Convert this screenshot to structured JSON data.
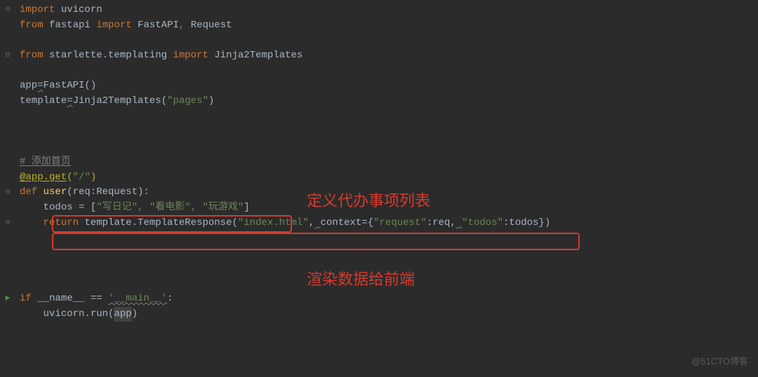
{
  "code": {
    "l1": {
      "kw1": "import",
      "mod": " uvicorn"
    },
    "l2": {
      "kw1": "from",
      "mod": " fastapi ",
      "kw2": "import",
      "names": " FastAPI",
      "comma": ", ",
      "names2": "Request"
    },
    "l4": {
      "kw1": "from",
      "mod": " starlette.templating ",
      "kw2": "import",
      "names": " Jinja2Templates"
    },
    "l6": {
      "var": "app",
      "eq": "=",
      "call": "FastAPI()"
    },
    "l7": {
      "var": "template",
      "eq": "=",
      "call": "Jinja2Templates(",
      "str": "\"pages\"",
      "end": ")"
    },
    "l11": {
      "comment": "# 添加首页"
    },
    "l12": {
      "dec": "@app.get",
      "open": "(",
      "str": "\"/\"",
      "close": ")"
    },
    "l13": {
      "kw": "def ",
      "fn": "user",
      "sig": "(req:Request):"
    },
    "l14": {
      "indent": "    ",
      "var": "todos = [",
      "s1": "\"写日记\"",
      "c1": ", ",
      "s2": "\"看电影\"",
      "c2": ", ",
      "s3": "\"玩游戏\"",
      "end": "]"
    },
    "l15": {
      "indent": "    ",
      "kw": "return",
      "sp": " ",
      "obj": "template.TemplateResponse(",
      "s1": "\"index.html\"",
      "c1": ",",
      "sq1": " ",
      "p1": "context",
      "eq": "={",
      "s2": "\"request\"",
      "col1": ":",
      "v1": "req",
      "c2": ",",
      "sq2": " ",
      "s3": "\"todos\"",
      "col2": ":",
      "v2": "todos})"
    },
    "l20": {
      "kw1": "if ",
      "name": "__name__",
      "op": " == ",
      "str": "'__main__'",
      "end": ":"
    },
    "l21": {
      "indent": "    ",
      "obj": "uvicorn.run(",
      "arg": "app",
      "end": ")"
    }
  },
  "annotations": {
    "top": "定义代办事项列表",
    "bottom": "渲染数据给前端"
  },
  "watermark": "@51CTO博客"
}
